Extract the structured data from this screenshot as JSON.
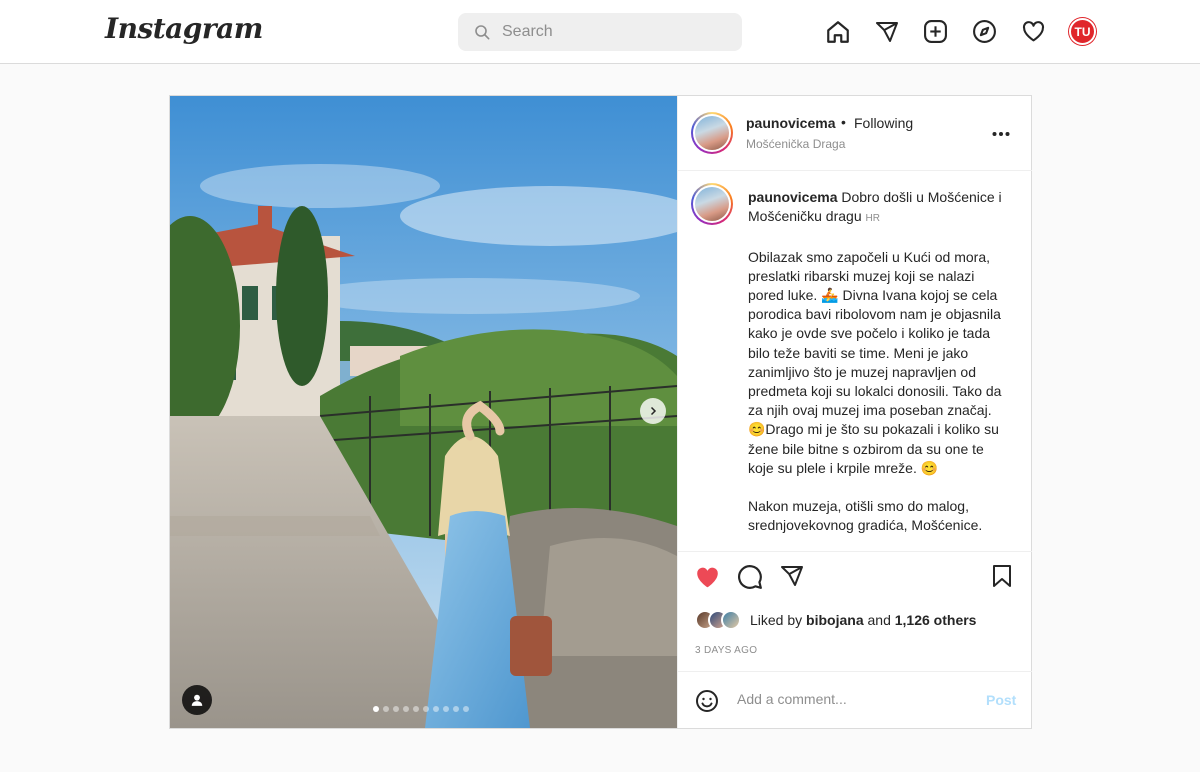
{
  "nav": {
    "logo": "Instagram",
    "search_placeholder": "Search",
    "icons": [
      "home-icon",
      "direct-message-icon",
      "new-post-icon",
      "explore-icon",
      "activity-heart-icon"
    ],
    "profile_initials": "TU"
  },
  "post": {
    "username": "paunovicema",
    "separator": "•",
    "follow_status": "Following",
    "location": "Mošćenička Draga",
    "caption": {
      "username": "paunovicema",
      "title": "Dobro došli u Mošćenice i Mošćeničku dragu",
      "language_tag": "HR",
      "body": "Obilazak smo započeli u Kući od mora, preslatki ribarski muzej koji se nalazi pored luke. 🚣 Divna Ivana kojoj se cela porodica bavi ribolovom nam je objasnila kako je ovde sve počelo i koliko je tada bilo teže baviti se time. Meni je jako zanimljivo što je muzej napravljen od predmeta koji su lokalci donosili. Tako da za njih ovaj muzej ima poseban značaj. 😊Drago mi je što su pokazali i koliko su žene bile bitne s ozbirom da su one te koje su plele i krpile mreže. 😊\n\nNakon muzeja, otišli smo do malog, srednjovekovnog gradića, Mošćenice."
    },
    "carousel": {
      "count": 10,
      "active_index": 0
    },
    "likes": {
      "prefix": "Liked by",
      "first_user": "bibojana",
      "conjunction": "and",
      "others": "1,126 others"
    },
    "date": "3 DAYS AGO",
    "comment_placeholder": "Add a comment...",
    "post_label": "Post",
    "liked": true
  },
  "colors": {
    "like_red": "#ed4956",
    "post_button": "#b2dffc",
    "profile_badge": "#e0262b"
  }
}
